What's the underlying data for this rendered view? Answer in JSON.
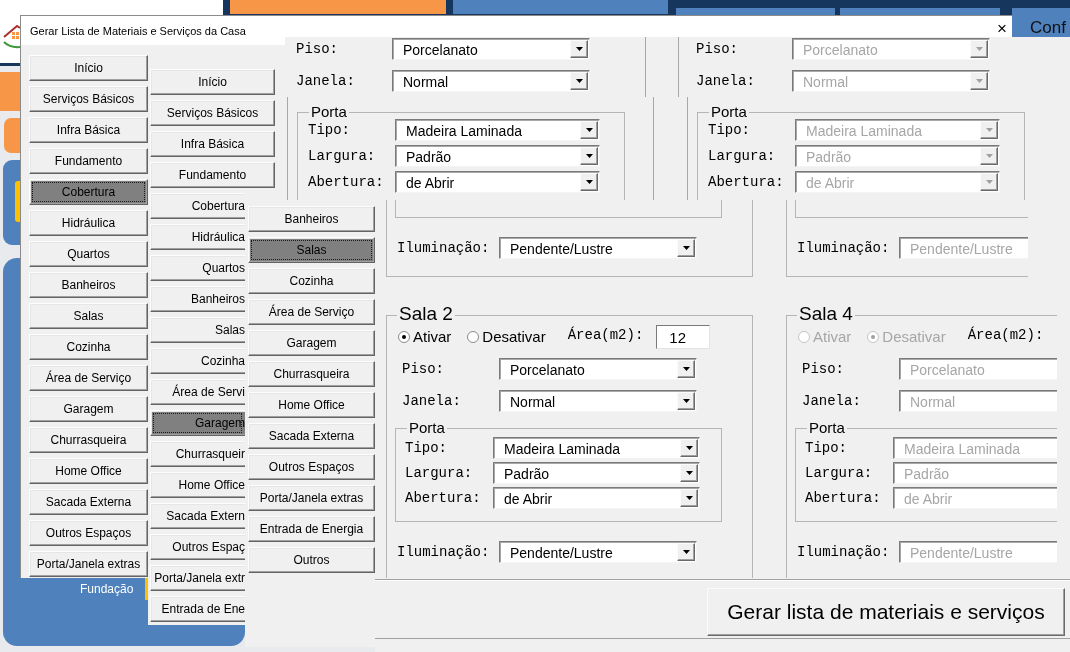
{
  "desktop": {
    "corner_button": "Conf",
    "panel_label": "Fundação"
  },
  "dialog": {
    "title": "Gerar Lista de Materiais e Serviços da Casa",
    "close": "×"
  },
  "nav_columns": [
    {
      "items": [
        {
          "label": "Início",
          "selected": false
        },
        {
          "label": "Serviços Básicos",
          "selected": false
        },
        {
          "label": "Infra Básica",
          "selected": false
        },
        {
          "label": "Fundamento",
          "selected": false
        },
        {
          "label": "Cobertura",
          "selected": true
        },
        {
          "label": "Hidráulica",
          "selected": false
        },
        {
          "label": "Quartos",
          "selected": false
        },
        {
          "label": "Banheiros",
          "selected": false
        },
        {
          "label": "Salas",
          "selected": false
        },
        {
          "label": "Cozinha",
          "selected": false
        },
        {
          "label": "Área de Serviço",
          "selected": false
        },
        {
          "label": "Garagem",
          "selected": false
        },
        {
          "label": "Churrasqueira",
          "selected": false
        },
        {
          "label": "Home Office",
          "selected": false
        },
        {
          "label": "Sacada Externa",
          "selected": false
        },
        {
          "label": "Outros Espaços",
          "selected": false
        },
        {
          "label": "Porta/Janela extras",
          "selected": false
        }
      ]
    },
    {
      "items": [
        {
          "label": "Início",
          "selected": false
        },
        {
          "label": "Serviços Básicos",
          "selected": false
        },
        {
          "label": "Infra Básica",
          "selected": false
        },
        {
          "label": "Fundamento",
          "selected": false
        },
        {
          "label": "Cobertura",
          "selected": false
        },
        {
          "label": "Hidráulica",
          "selected": false
        },
        {
          "label": "Quartos",
          "selected": false
        },
        {
          "label": "Banheiros",
          "selected": false
        },
        {
          "label": "Salas",
          "selected": false
        },
        {
          "label": "Cozinha",
          "selected": false
        },
        {
          "label": "Área de Servi",
          "selected": false
        },
        {
          "label": "Garagem",
          "selected": true
        },
        {
          "label": "Churrasqueir",
          "selected": false
        },
        {
          "label": "Home Office",
          "selected": false
        },
        {
          "label": "Sacada Extern",
          "selected": false
        },
        {
          "label": "Outros Espaç",
          "selected": false
        },
        {
          "label": "Porta/Janela extr",
          "selected": false
        },
        {
          "label": "Entrada de Ene",
          "selected": false
        }
      ]
    },
    {
      "items": [
        {
          "label": "Banheiros",
          "selected": false
        },
        {
          "label": "Salas",
          "selected": true
        },
        {
          "label": "Cozinha",
          "selected": false
        },
        {
          "label": "Área de Serviço",
          "selected": false
        },
        {
          "label": "Garagem",
          "selected": false
        },
        {
          "label": "Churrasqueira",
          "selected": false
        },
        {
          "label": "Home Office",
          "selected": false
        },
        {
          "label": "Sacada Externa",
          "selected": false
        },
        {
          "label": "Outros Espaços",
          "selected": false
        },
        {
          "label": "Porta/Janela extras",
          "selected": false
        },
        {
          "label": "Entrada de Energia",
          "selected": false
        },
        {
          "label": "Outros",
          "selected": false
        }
      ]
    }
  ],
  "stale_rooms": [
    {
      "disabled": false,
      "fields": [
        {
          "label": "Piso:",
          "value": "Porcelanato"
        },
        {
          "label": "Janela:",
          "value": "Normal"
        }
      ],
      "door": {
        "legend": "Porta",
        "fields": [
          {
            "label": "Tipo:",
            "value": "Madeira Laminada"
          },
          {
            "label": "Largura:",
            "value": "Padrão"
          },
          {
            "label": "Abertura:",
            "value": "de Abrir"
          }
        ]
      }
    },
    {
      "disabled": true,
      "fields": [
        {
          "label": "Piso:",
          "value": "Porcelanato"
        },
        {
          "label": "Janela:",
          "value": "Normal"
        }
      ],
      "door": {
        "legend": "Porta",
        "fields": [
          {
            "label": "Tipo:",
            "value": "Madeira Laminada"
          },
          {
            "label": "Largura:",
            "value": "Padrão"
          },
          {
            "label": "Abertura:",
            "value": "de Abrir"
          }
        ]
      }
    }
  ],
  "room_tails": [
    {
      "disabled": false,
      "lighting": {
        "label": "Iluminação:",
        "value": "Pendente/Lustre"
      }
    },
    {
      "disabled": true,
      "lighting": {
        "label": "Iluminação:",
        "value": "Pendente/Lustre"
      }
    }
  ],
  "rooms": [
    {
      "title": "Sala 2",
      "disabled": false,
      "options": [
        {
          "label": "Ativar",
          "selected": true
        },
        {
          "label": "Desativar",
          "selected": false
        }
      ],
      "area": {
        "label": "Área(m2):",
        "value": "12"
      },
      "fields": [
        {
          "label": "Piso:",
          "value": "Porcelanato"
        },
        {
          "label": "Janela:",
          "value": "Normal"
        }
      ],
      "door": {
        "legend": "Porta",
        "fields": [
          {
            "label": "Tipo:",
            "value": "Madeira Laminada"
          },
          {
            "label": "Largura:",
            "value": "Padrão"
          },
          {
            "label": "Abertura:",
            "value": "de Abrir"
          }
        ]
      },
      "lighting": {
        "label": "Iluminação:",
        "value": "Pendente/Lustre"
      }
    },
    {
      "title": "Sala 4",
      "disabled": true,
      "options": [
        {
          "label": "Ativar",
          "selected": false
        },
        {
          "label": "Desativar",
          "selected": true
        }
      ],
      "area": {
        "label": "Área(m2):"
      },
      "fields": [
        {
          "label": "Piso:",
          "value": "Porcelanato"
        },
        {
          "label": "Janela:",
          "value": "Normal"
        }
      ],
      "door": {
        "legend": "Porta",
        "fields": [
          {
            "label": "Tipo:",
            "value": "Madeira Laminada"
          },
          {
            "label": "Largura:",
            "value": "Padrão"
          },
          {
            "label": "Abertura:",
            "value": "de Abrir"
          }
        ]
      },
      "lighting": {
        "label": "Iluminação:",
        "value": "Pendente/Lustre"
      }
    }
  ],
  "generate_button": "Gerar lista de materiais e serviços"
}
